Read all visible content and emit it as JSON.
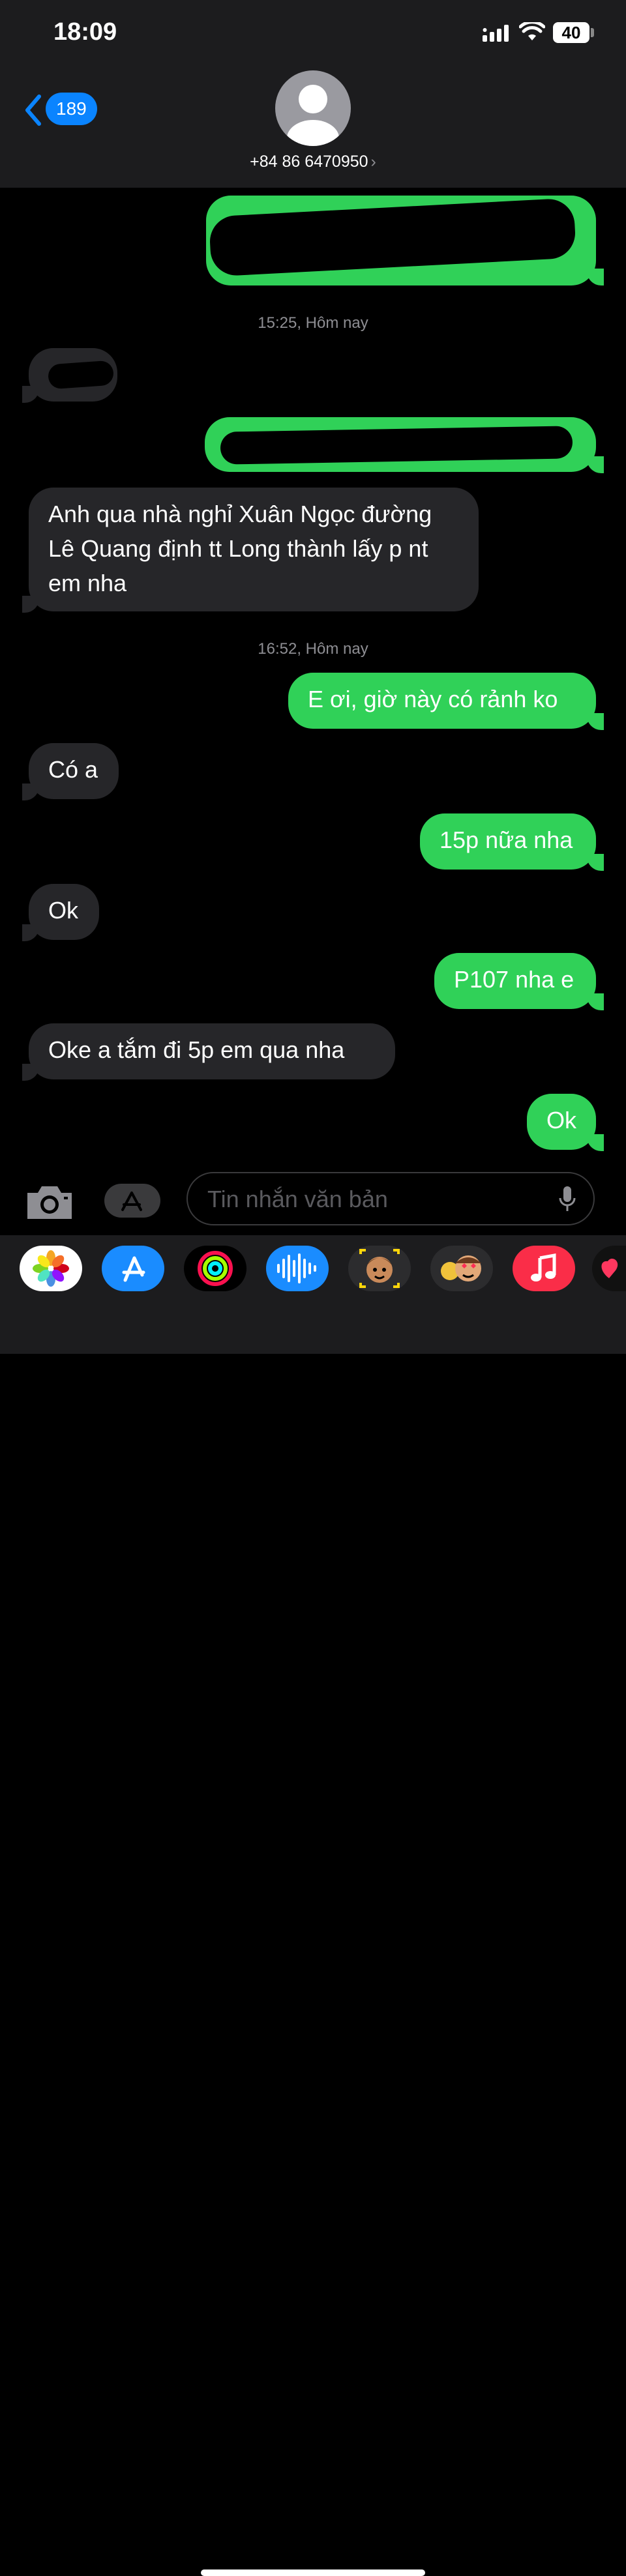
{
  "status_bar": {
    "time": "18:09",
    "battery": "40"
  },
  "header": {
    "back_count": "189",
    "contact": "+84 86 6470950",
    "contact_chevron": "›"
  },
  "conversation": {
    "timestamps": [
      "15:25, Hôm nay",
      "16:52, Hôm nay"
    ],
    "messages": [
      {
        "from": "me",
        "text": ""
      },
      {
        "from": "them",
        "text": ""
      },
      {
        "from": "me",
        "text": ""
      },
      {
        "from": "them",
        "text": "Anh qua nhà nghỉ Xuân Ngọc đường Lê Quang định tt Long thành lấy p nt em nha"
      },
      {
        "from": "me",
        "text": "E ơi, giờ này có rảnh ko"
      },
      {
        "from": "them",
        "text": "Có a"
      },
      {
        "from": "me",
        "text": "15p nữa nha"
      },
      {
        "from": "them",
        "text": "Ok"
      },
      {
        "from": "me",
        "text": "P107 nha e"
      },
      {
        "from": "them",
        "text": "Oke a tắm đi 5p em qua nha"
      },
      {
        "from": "me",
        "text": "Ok"
      }
    ]
  },
  "composer": {
    "placeholder": "Tin nhắn văn bản"
  },
  "app_strip": {
    "apps": [
      "photos-icon",
      "app-store-icon",
      "fitness-icon",
      "voice-memo-icon",
      "memoji-icon",
      "memoji-stickers-icon",
      "music-icon",
      "digital-touch-icon"
    ]
  },
  "colors": {
    "sent": "#30d158",
    "received": "#262629",
    "accent": "#0a84ff",
    "background": "#000000"
  }
}
